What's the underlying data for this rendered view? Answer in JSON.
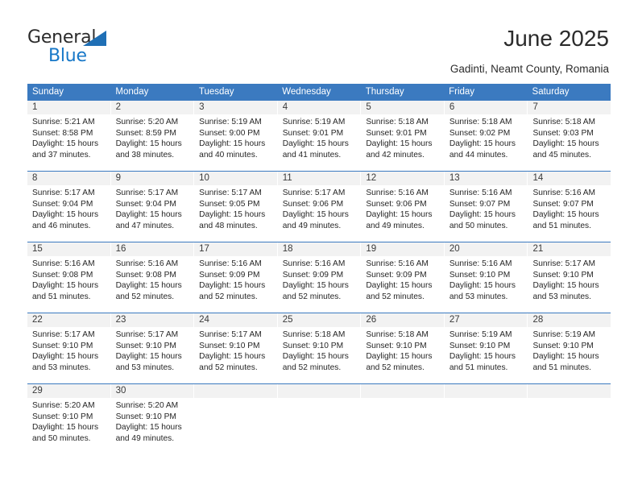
{
  "brand": {
    "name_part1": "General",
    "name_part2": "Blue",
    "accent_color": "#1878c8",
    "triangle_color": "#1f6fb5"
  },
  "header": {
    "title": "June 2025",
    "subtitle": "Gadinti, Neamt County, Romania"
  },
  "calendar": {
    "header_color": "#3b7ac0",
    "daynum_band_color": "#f2f2f2",
    "weekdays": [
      "Sunday",
      "Monday",
      "Tuesday",
      "Wednesday",
      "Thursday",
      "Friday",
      "Saturday"
    ],
    "weeks": [
      [
        {
          "day": "1",
          "lines": [
            "Sunrise: 5:21 AM",
            "Sunset: 8:58 PM",
            "Daylight: 15 hours",
            "and 37 minutes."
          ]
        },
        {
          "day": "2",
          "lines": [
            "Sunrise: 5:20 AM",
            "Sunset: 8:59 PM",
            "Daylight: 15 hours",
            "and 38 minutes."
          ]
        },
        {
          "day": "3",
          "lines": [
            "Sunrise: 5:19 AM",
            "Sunset: 9:00 PM",
            "Daylight: 15 hours",
            "and 40 minutes."
          ]
        },
        {
          "day": "4",
          "lines": [
            "Sunrise: 5:19 AM",
            "Sunset: 9:01 PM",
            "Daylight: 15 hours",
            "and 41 minutes."
          ]
        },
        {
          "day": "5",
          "lines": [
            "Sunrise: 5:18 AM",
            "Sunset: 9:01 PM",
            "Daylight: 15 hours",
            "and 42 minutes."
          ]
        },
        {
          "day": "6",
          "lines": [
            "Sunrise: 5:18 AM",
            "Sunset: 9:02 PM",
            "Daylight: 15 hours",
            "and 44 minutes."
          ]
        },
        {
          "day": "7",
          "lines": [
            "Sunrise: 5:18 AM",
            "Sunset: 9:03 PM",
            "Daylight: 15 hours",
            "and 45 minutes."
          ]
        }
      ],
      [
        {
          "day": "8",
          "lines": [
            "Sunrise: 5:17 AM",
            "Sunset: 9:04 PM",
            "Daylight: 15 hours",
            "and 46 minutes."
          ]
        },
        {
          "day": "9",
          "lines": [
            "Sunrise: 5:17 AM",
            "Sunset: 9:04 PM",
            "Daylight: 15 hours",
            "and 47 minutes."
          ]
        },
        {
          "day": "10",
          "lines": [
            "Sunrise: 5:17 AM",
            "Sunset: 9:05 PM",
            "Daylight: 15 hours",
            "and 48 minutes."
          ]
        },
        {
          "day": "11",
          "lines": [
            "Sunrise: 5:17 AM",
            "Sunset: 9:06 PM",
            "Daylight: 15 hours",
            "and 49 minutes."
          ]
        },
        {
          "day": "12",
          "lines": [
            "Sunrise: 5:16 AM",
            "Sunset: 9:06 PM",
            "Daylight: 15 hours",
            "and 49 minutes."
          ]
        },
        {
          "day": "13",
          "lines": [
            "Sunrise: 5:16 AM",
            "Sunset: 9:07 PM",
            "Daylight: 15 hours",
            "and 50 minutes."
          ]
        },
        {
          "day": "14",
          "lines": [
            "Sunrise: 5:16 AM",
            "Sunset: 9:07 PM",
            "Daylight: 15 hours",
            "and 51 minutes."
          ]
        }
      ],
      [
        {
          "day": "15",
          "lines": [
            "Sunrise: 5:16 AM",
            "Sunset: 9:08 PM",
            "Daylight: 15 hours",
            "and 51 minutes."
          ]
        },
        {
          "day": "16",
          "lines": [
            "Sunrise: 5:16 AM",
            "Sunset: 9:08 PM",
            "Daylight: 15 hours",
            "and 52 minutes."
          ]
        },
        {
          "day": "17",
          "lines": [
            "Sunrise: 5:16 AM",
            "Sunset: 9:09 PM",
            "Daylight: 15 hours",
            "and 52 minutes."
          ]
        },
        {
          "day": "18",
          "lines": [
            "Sunrise: 5:16 AM",
            "Sunset: 9:09 PM",
            "Daylight: 15 hours",
            "and 52 minutes."
          ]
        },
        {
          "day": "19",
          "lines": [
            "Sunrise: 5:16 AM",
            "Sunset: 9:09 PM",
            "Daylight: 15 hours",
            "and 52 minutes."
          ]
        },
        {
          "day": "20",
          "lines": [
            "Sunrise: 5:16 AM",
            "Sunset: 9:10 PM",
            "Daylight: 15 hours",
            "and 53 minutes."
          ]
        },
        {
          "day": "21",
          "lines": [
            "Sunrise: 5:17 AM",
            "Sunset: 9:10 PM",
            "Daylight: 15 hours",
            "and 53 minutes."
          ]
        }
      ],
      [
        {
          "day": "22",
          "lines": [
            "Sunrise: 5:17 AM",
            "Sunset: 9:10 PM",
            "Daylight: 15 hours",
            "and 53 minutes."
          ]
        },
        {
          "day": "23",
          "lines": [
            "Sunrise: 5:17 AM",
            "Sunset: 9:10 PM",
            "Daylight: 15 hours",
            "and 53 minutes."
          ]
        },
        {
          "day": "24",
          "lines": [
            "Sunrise: 5:17 AM",
            "Sunset: 9:10 PM",
            "Daylight: 15 hours",
            "and 52 minutes."
          ]
        },
        {
          "day": "25",
          "lines": [
            "Sunrise: 5:18 AM",
            "Sunset: 9:10 PM",
            "Daylight: 15 hours",
            "and 52 minutes."
          ]
        },
        {
          "day": "26",
          "lines": [
            "Sunrise: 5:18 AM",
            "Sunset: 9:10 PM",
            "Daylight: 15 hours",
            "and 52 minutes."
          ]
        },
        {
          "day": "27",
          "lines": [
            "Sunrise: 5:19 AM",
            "Sunset: 9:10 PM",
            "Daylight: 15 hours",
            "and 51 minutes."
          ]
        },
        {
          "day": "28",
          "lines": [
            "Sunrise: 5:19 AM",
            "Sunset: 9:10 PM",
            "Daylight: 15 hours",
            "and 51 minutes."
          ]
        }
      ],
      [
        {
          "day": "29",
          "lines": [
            "Sunrise: 5:20 AM",
            "Sunset: 9:10 PM",
            "Daylight: 15 hours",
            "and 50 minutes."
          ]
        },
        {
          "day": "30",
          "lines": [
            "Sunrise: 5:20 AM",
            "Sunset: 9:10 PM",
            "Daylight: 15 hours",
            "and 49 minutes."
          ]
        },
        {
          "day": "",
          "lines": []
        },
        {
          "day": "",
          "lines": []
        },
        {
          "day": "",
          "lines": []
        },
        {
          "day": "",
          "lines": []
        },
        {
          "day": "",
          "lines": []
        }
      ]
    ]
  }
}
